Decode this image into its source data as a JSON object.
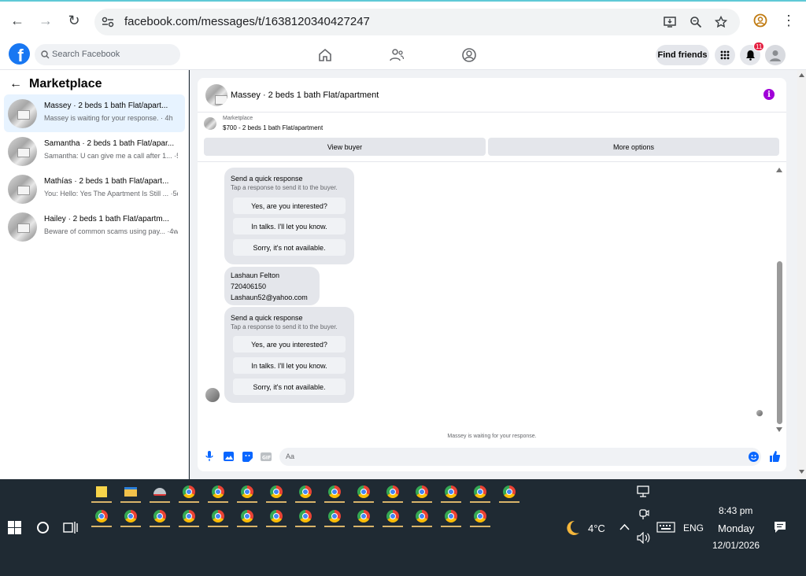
{
  "browser": {
    "url": "facebook.com/messages/t/1638120340427247"
  },
  "header": {
    "search_placeholder": "Search Facebook",
    "find_friends": "Find friends",
    "notification_count": "11"
  },
  "sidebar": {
    "title": "Marketplace",
    "conversations": [
      {
        "name": "Massey · 2 beds 1 bath Flat/apart...",
        "message": "Massey is waiting for your response. · 4h"
      },
      {
        "name": "Samantha · 2 beds 1 bath Flat/apar...",
        "message": "Samantha: U can give me a call after 1... ·5h"
      },
      {
        "name": "Mathías · 2 beds 1 bath Flat/apart...",
        "message": "You: Hello: Yes The Apartment Is Still ... ·5d"
      },
      {
        "name": "Hailey · 2 beds 1 bath Flat/apartm...",
        "message": "Beware of common scams using pay... ·4w"
      }
    ]
  },
  "chat": {
    "title": "Massey · 2 beds 1 bath Flat/apartment",
    "listing_label": "Marketplace",
    "listing_price": "$700 - 2 beds 1 bath Flat/apartment",
    "view_buyer": "View buyer",
    "more_options": "More options",
    "quick_response": {
      "title": "Send a quick response",
      "subtitle": "Tap a response to send it to the buyer.",
      "options": [
        "Yes, are you interested?",
        "In talks. I'll let you know.",
        "Sorry, it's not available."
      ]
    },
    "contact": {
      "name": "Lashaun Felton",
      "phone": "720406150",
      "email": "Lashaun52@yahoo.com"
    },
    "waiting_text": "Massey is waiting for your response.",
    "composer_placeholder": "Aa"
  },
  "taskbar": {
    "weather": "4°C",
    "language": "ENG",
    "time": "8:43 pm",
    "day": "Monday",
    "date": "12/01/2026"
  }
}
